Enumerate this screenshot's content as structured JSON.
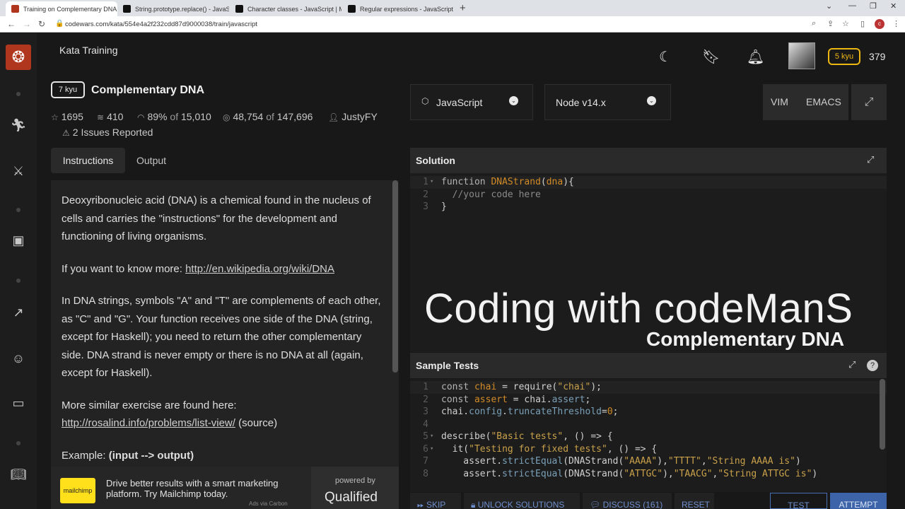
{
  "browser": {
    "tabs": [
      {
        "title": "Training on Complementary DNA",
        "favicon_color": "#b1361e"
      },
      {
        "title": "String.prototype.replace() - JavaS",
        "favicon_color": "#111111"
      },
      {
        "title": "Character classes - JavaScript | M",
        "favicon_color": "#111111"
      },
      {
        "title": "Regular expressions - JavaScript",
        "favicon_color": "#111111"
      }
    ],
    "url": "codewars.com/kata/554e4a2f232cdd87d9000038/train/javascript",
    "profile_initial": "c"
  },
  "header": {
    "section_title": "Kata Training",
    "user_rank": "5 kyu",
    "honor": "379"
  },
  "kata": {
    "rank": "7 kyu",
    "title": "Complementary DNA",
    "stars": "1695",
    "collections": "410",
    "satisfaction": "89%",
    "of_word": "of",
    "satisfaction_votes": "15,010",
    "completed": "48,754",
    "attempts": "147,696",
    "author": "JustyFY",
    "issues": "2 Issues Reported"
  },
  "tabs": {
    "instructions": "Instructions",
    "output": "Output"
  },
  "description": {
    "p1": "Deoxyribonucleic acid (DNA) is a chemical found in the nucleus of cells and carries the \"instructions\" for the development and functioning of living organisms.",
    "p2_prefix": "If you want to know more: ",
    "p2_link": "http://en.wikipedia.org/wiki/DNA",
    "p3": "In DNA strings, symbols \"A\" and \"T\" are complements of each other, as \"C\" and \"G\". Your function receives one side of the DNA (string, except for Haskell); you need to return the other complementary side. DNA strand is never empty or there is no DNA at all (again, except for Haskell).",
    "p4_prefix": "More similar exercise are found here: ",
    "p4_link": "http://rosalind.info/problems/list-view/",
    "p4_suffix": " (source)",
    "p5_prefix": "Example: ",
    "p5_bold": "(input --> output)"
  },
  "ad": {
    "logo_text": "mailchimp",
    "text": "Drive better results with a smart marketing platform. Try Mailchimp today.",
    "byline": "Ads via Carbon",
    "powered_by": "powered by",
    "brand": "Qualified"
  },
  "editor": {
    "language": "JavaScript",
    "version": "Node v14.x",
    "mode_vim": "VIM",
    "mode_emacs": "EMACS",
    "solution_title": "Solution",
    "tests_title": "Sample Tests"
  },
  "solution_code": [
    {
      "n": "1",
      "fold": "▾",
      "parts": [
        [
          "k",
          "function "
        ],
        [
          "f",
          "DNAStrand"
        ],
        [
          "p",
          "("
        ],
        [
          "v",
          "dna"
        ],
        [
          "p",
          "){"
        ]
      ]
    },
    {
      "n": "2",
      "fold": "",
      "parts": [
        [
          "c",
          "  //your code here"
        ]
      ]
    },
    {
      "n": "3",
      "fold": "",
      "parts": [
        [
          "p",
          "}"
        ]
      ]
    }
  ],
  "test_code": [
    {
      "n": "1",
      "fold": "",
      "parts": [
        [
          "k",
          "const "
        ],
        [
          "v",
          "chai"
        ],
        [
          "p",
          " = require("
        ],
        [
          "s",
          "\"chai\""
        ],
        [
          "p",
          ");"
        ]
      ]
    },
    {
      "n": "2",
      "fold": "",
      "parts": [
        [
          "k",
          "const "
        ],
        [
          "v",
          "assert"
        ],
        [
          "p",
          " = chai."
        ],
        [
          "m",
          "assert"
        ],
        [
          "p",
          ";"
        ]
      ]
    },
    {
      "n": "3",
      "fold": "",
      "parts": [
        [
          "p",
          "chai."
        ],
        [
          "m",
          "config"
        ],
        [
          "p",
          "."
        ],
        [
          "m",
          "truncateThreshold"
        ],
        [
          "p",
          "="
        ],
        [
          "f",
          "0"
        ],
        [
          "p",
          ";"
        ]
      ]
    },
    {
      "n": "4",
      "fold": "",
      "parts": [
        [
          "p",
          ""
        ]
      ]
    },
    {
      "n": "5",
      "fold": "▾",
      "parts": [
        [
          "p",
          "describe("
        ],
        [
          "s",
          "\"Basic tests\""
        ],
        [
          "p",
          ", () => {"
        ]
      ]
    },
    {
      "n": "6",
      "fold": "▾",
      "parts": [
        [
          "p",
          "  it("
        ],
        [
          "s",
          "\"Testing for fixed tests\""
        ],
        [
          "p",
          ", () => {"
        ]
      ]
    },
    {
      "n": "7",
      "fold": "",
      "parts": [
        [
          "p",
          "    assert."
        ],
        [
          "m",
          "strictEqual"
        ],
        [
          "p",
          "(DNAStrand("
        ],
        [
          "s",
          "\"AAAA\""
        ],
        [
          "p",
          "),"
        ],
        [
          "s",
          "\"TTTT\""
        ],
        [
          "p",
          ","
        ],
        [
          "s",
          "\"String AAAA is\""
        ],
        [
          "p",
          ")"
        ]
      ]
    },
    {
      "n": "8",
      "fold": "",
      "parts": [
        [
          "p",
          "    assert."
        ],
        [
          "m",
          "strictEqual"
        ],
        [
          "p",
          "(DNAStrand("
        ],
        [
          "s",
          "\"ATTGC\""
        ],
        [
          "p",
          "),"
        ],
        [
          "s",
          "\"TAACG\""
        ],
        [
          "p",
          ","
        ],
        [
          "s",
          "\"String ATTGC is\""
        ],
        [
          "p",
          ")"
        ]
      ]
    }
  ],
  "watermark": {
    "line1": "Coding with codeManS",
    "line2": "Complementary DNA"
  },
  "actions": {
    "skip": "SKIP",
    "unlock": "UNLOCK SOLUTIONS",
    "discuss": "DISCUSS (161)",
    "reset": "RESET",
    "test": "TEST",
    "attempt": "ATTEMPT"
  }
}
